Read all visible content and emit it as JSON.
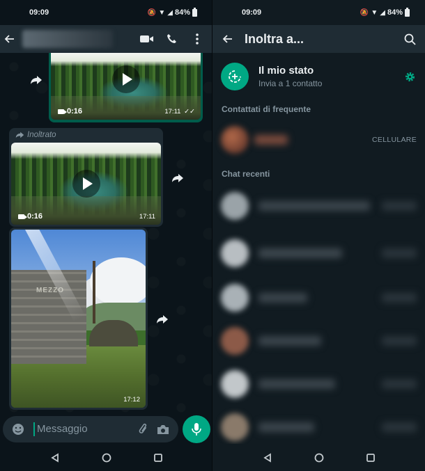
{
  "status_bar": {
    "time": "09:09",
    "battery": "84%"
  },
  "left": {
    "messages": [
      {
        "type": "video",
        "duration": "0:16",
        "time": "17:11",
        "ticks": "✓✓"
      },
      {
        "type": "video",
        "forwarded_label": "Inoltrato",
        "duration": "0:16",
        "time": "17:11"
      },
      {
        "type": "photo",
        "sign_text": "MEZZO",
        "time": "17:12"
      }
    ],
    "composer": {
      "placeholder": "Messaggio"
    }
  },
  "right": {
    "title": "Inoltra a...",
    "my_status": {
      "title": "Il mio stato",
      "subtitle": "Invia a 1 contatto"
    },
    "sections": {
      "frequent": "Contattati di frequente",
      "recent": "Chat recenti"
    },
    "frequent_contact": {
      "label": "CELLULARE"
    }
  },
  "colors": {
    "accent": "#00a884",
    "background": "#0b141a",
    "bar": "#1f2c34",
    "muted": "#8696a0"
  },
  "icons": [
    "back-arrow-icon",
    "video-call-icon",
    "phone-icon",
    "more-vert-icon",
    "forward-icon",
    "search-icon",
    "settings-icon",
    "emoji-icon",
    "attach-icon",
    "camera-icon",
    "mic-icon",
    "status-add-icon"
  ]
}
